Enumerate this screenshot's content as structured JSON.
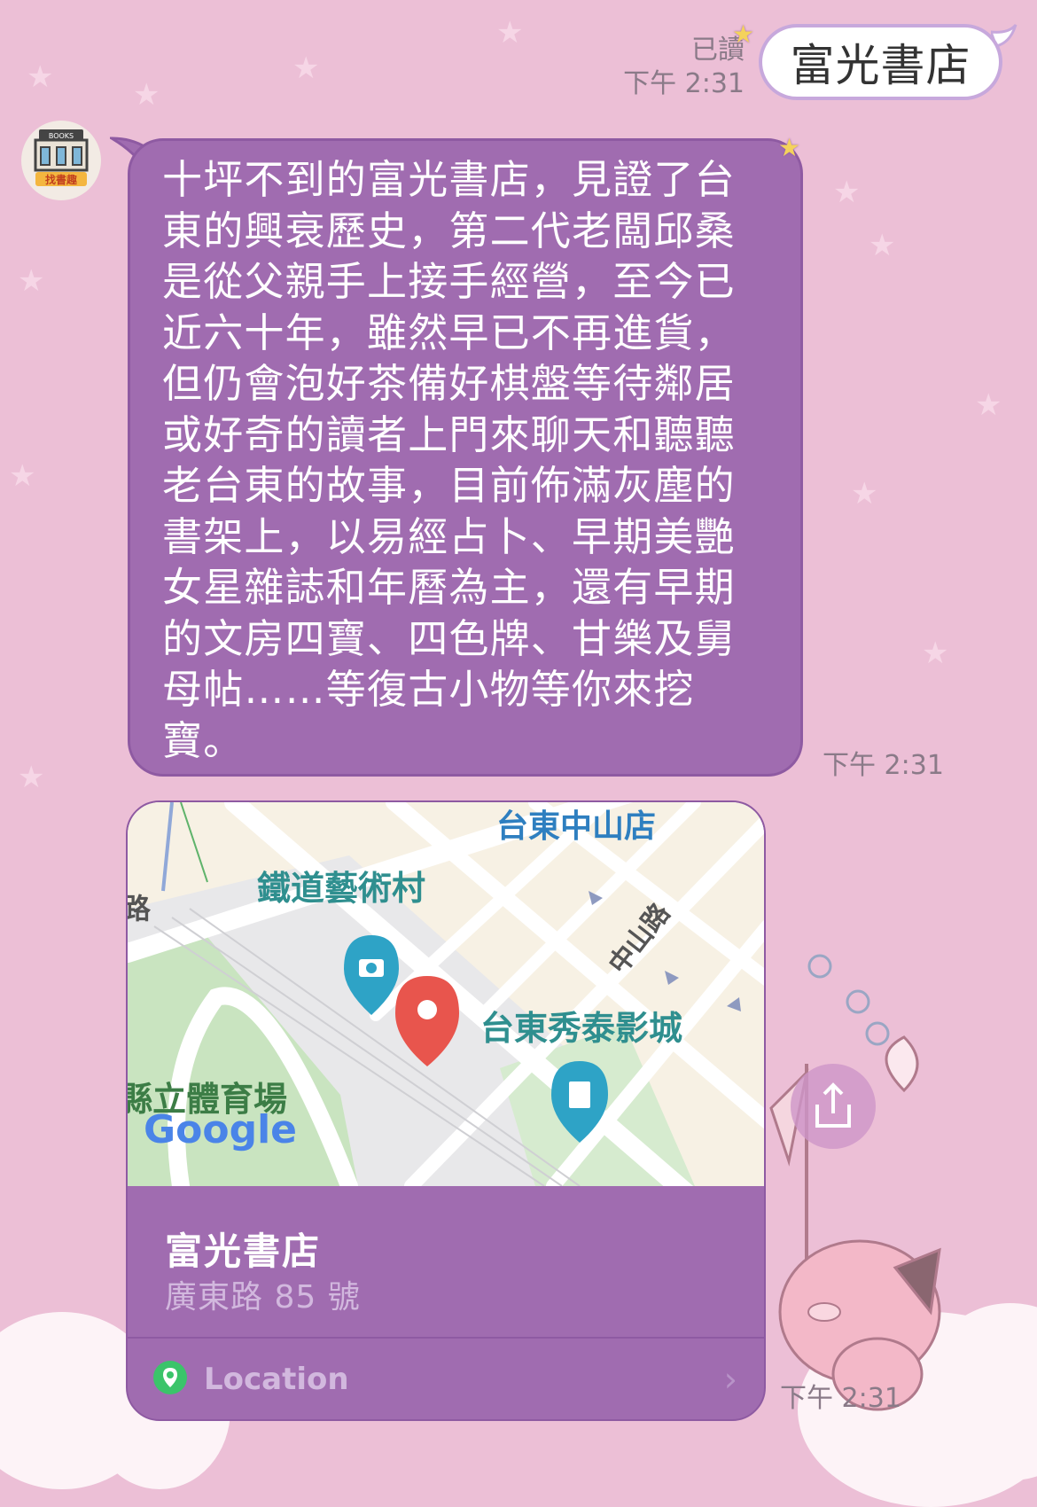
{
  "chat": {
    "outgoing": {
      "read_status": "已讀",
      "time": "下午 2:31",
      "text": "富光書店"
    },
    "avatar": {
      "name": "avatar",
      "badge_top": "BOOKS",
      "badge_bottom": "找書趣"
    },
    "incoming_text": {
      "text": "十坪不到的富光書店，見證了台東的興衰歷史，第二代老闆邱桑是從父親手上接手經營，至今已近六十年，雖然早已不再進貨，但仍會泡好茶備好棋盤等待鄰居或好奇的讀者上門來聊天和聽聽老台東的故事，目前佈滿灰塵的書架上，以易經占卜、早期美艷女星雜誌和年曆為主，還有早期的文房四寶、四色牌、甘樂及舅母帖……等復古小物等你來挖寶。",
      "time": "下午 2:31"
    },
    "location": {
      "name": "富光書店",
      "address": "廣東路 85 號",
      "footer_label": "Location",
      "time": "下午 2:31",
      "map_labels": {
        "store": "台東中山店",
        "railway_art_village": "鐵道藝術村",
        "zhongshan_road": "中山路",
        "cinema": "台東秀泰影城",
        "stadium": "縣立體育場",
        "road_fragment": "路",
        "google": "Google"
      }
    }
  },
  "icons": {
    "share": "share-icon",
    "location_pin": "location-pin-icon",
    "chevron": "chevron-right-icon"
  },
  "colors": {
    "background": "#ecbfd6",
    "incoming_bubble": "#a06cb0",
    "outgoing_bubble": "#ffffff",
    "map_pin": "#e8554d",
    "map_poi": "#2ea3c6"
  }
}
